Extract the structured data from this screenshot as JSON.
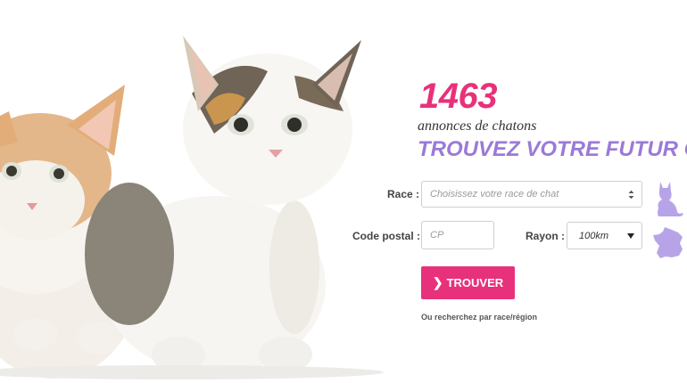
{
  "hero": {
    "image": "two-kittens-photo"
  },
  "stats": {
    "count": "1463",
    "count_label": "annonces de chatons"
  },
  "headline": "TROUVEZ VOTRE FUTUR CHA",
  "form": {
    "race": {
      "label": "Race :",
      "placeholder": "Choisissez votre race de chat"
    },
    "postal_code": {
      "label": "Code postal :",
      "placeholder": "CP"
    },
    "radius": {
      "label": "Rayon :",
      "value": "100km"
    },
    "submit_label": "TROUVER",
    "alt_search_link": "Ou recherchez par race/région"
  },
  "icons": {
    "race": "cat-icon",
    "radius": "france-map-icon",
    "submit": "chevron-right-icon"
  },
  "colors": {
    "accent_pink": "#e8317b",
    "headline_purple": "#9a7ad6",
    "icon_lavender": "#b7a4e8"
  }
}
